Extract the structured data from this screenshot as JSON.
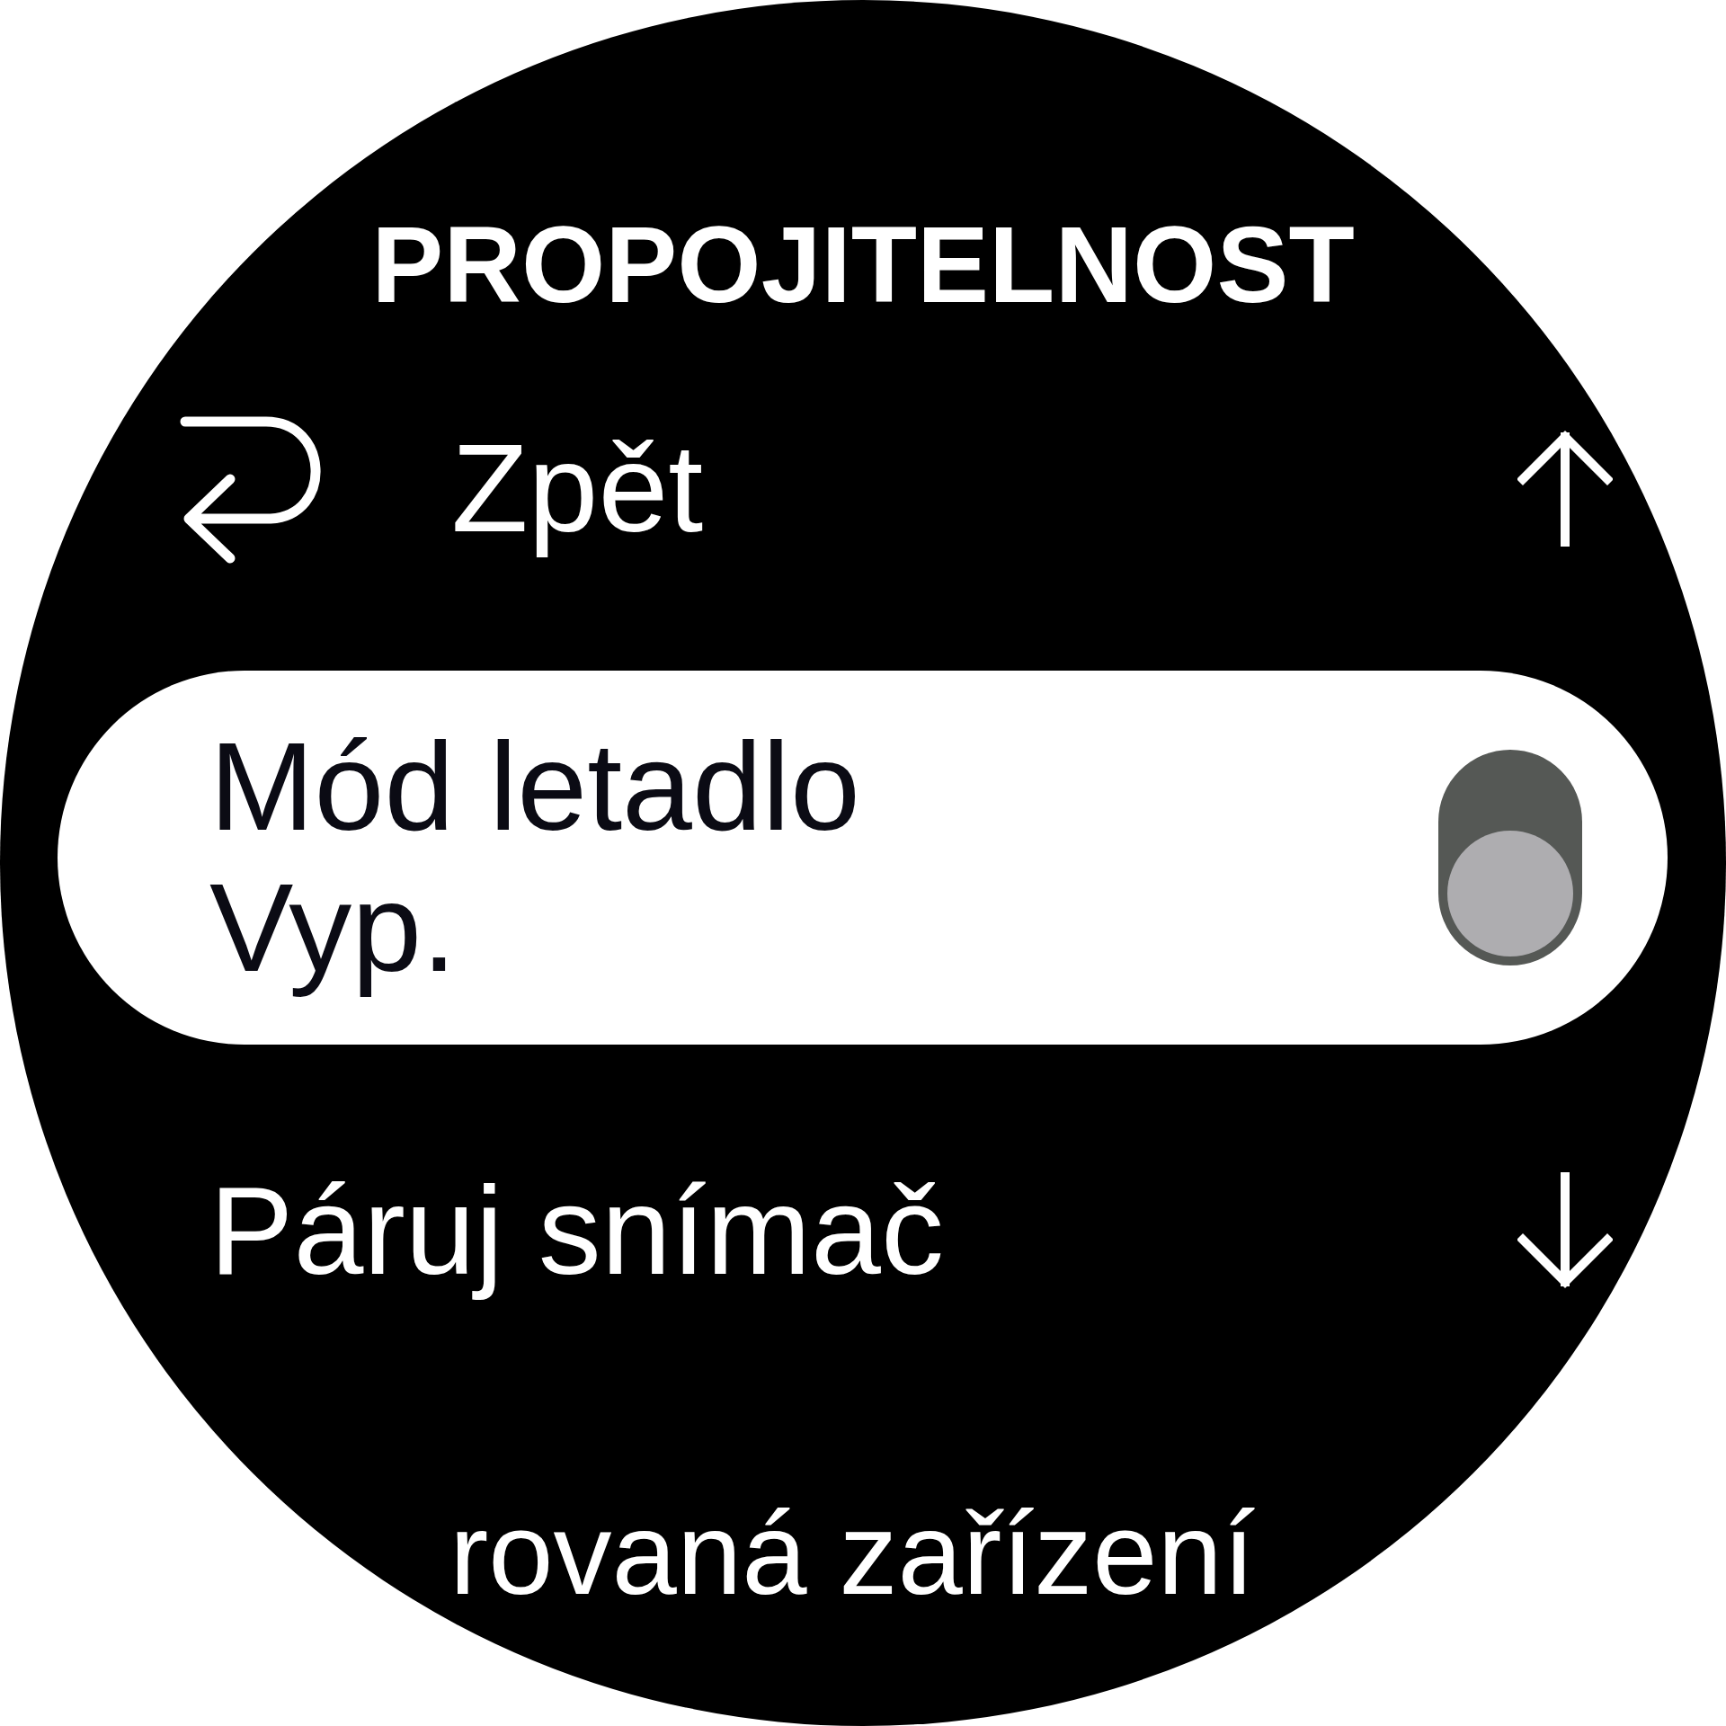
{
  "title": "PROPOJITELNOST",
  "items": [
    {
      "kind": "back",
      "label": "Zpět",
      "selected": false
    },
    {
      "kind": "toggle",
      "label": "Mód letadlo",
      "value": "Vyp.",
      "on": false,
      "selected": true
    },
    {
      "kind": "link",
      "label": "Páruj snímač",
      "selected": false
    },
    {
      "kind": "link",
      "label": "rovaná zařízení",
      "selected": false
    }
  ]
}
